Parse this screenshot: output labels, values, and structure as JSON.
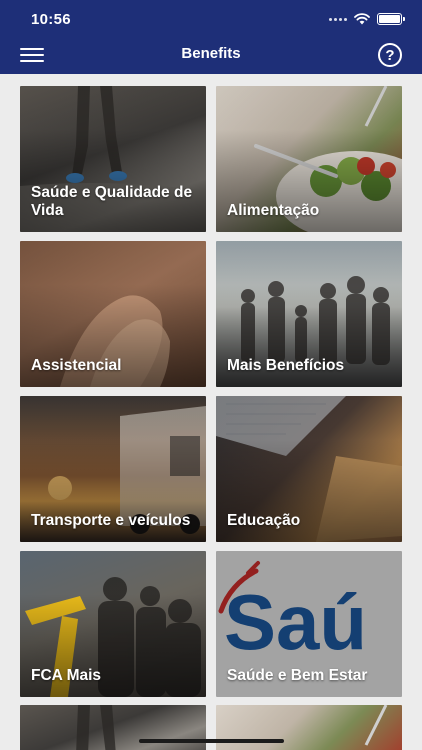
{
  "status": {
    "time": "10:56"
  },
  "nav": {
    "title": "Benefits",
    "help_symbol": "?"
  },
  "tiles": [
    {
      "label": "Saúde e Qualidade de Vida"
    },
    {
      "label": "Alimentação"
    },
    {
      "label": "Assistencial"
    },
    {
      "label": "Mais Benefícios"
    },
    {
      "label": "Transporte e veículos"
    },
    {
      "label": "Educação"
    },
    {
      "label": "FCA Mais"
    },
    {
      "label": "Saúde e Bem Estar"
    }
  ],
  "bemestar_logo_text": "Saú",
  "colors": {
    "nav": "#1e2f78",
    "background": "#ececec",
    "logo_blue": "#1e5ea8",
    "logo_red": "#d9302e"
  }
}
